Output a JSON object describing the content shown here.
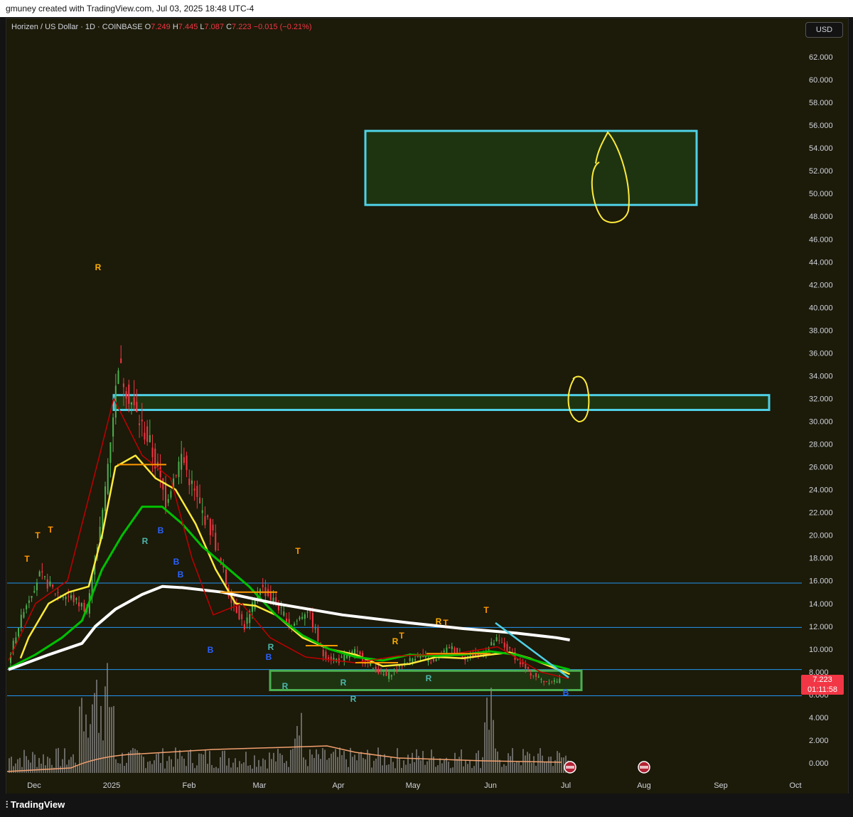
{
  "header": {
    "attribution": "gmuney created with TradingView.com, Jul 03, 2025 18:48 UTC-4"
  },
  "legend": {
    "symbol": "Horizen / US Dollar · 1D · COINBASE",
    "open_label": "O",
    "open": "7.249",
    "high_label": "H",
    "high": "7.445",
    "low_label": "L",
    "low": "7.087",
    "close_label": "C",
    "close": "7.223",
    "change": "−0.015 (−0.21%)"
  },
  "currency_button": "USD",
  "last_price": {
    "price": "7.223",
    "countdown": "01:11:58"
  },
  "footer": {
    "brand": "TradingView"
  },
  "colors": {
    "background": "#1c1a09",
    "up": "#4caf50",
    "down": "#f23645",
    "zone_fill": "#1f3a12",
    "zone_border_cyan": "#4fd1e6",
    "zone_border_green": "#4caf50",
    "ema_short": "#ffeb3b",
    "ema_mid": "#00c000",
    "ema_long": "#ffffff",
    "ema_red": "#c00000",
    "hlines": "#2196f3",
    "annotation": "#ffeb3b"
  },
  "chart_data": {
    "type": "candlestick",
    "title": "Horizen / US Dollar · 1D · COINBASE",
    "y_axis": {
      "ticks": [
        "62.000",
        "60.000",
        "58.000",
        "56.000",
        "54.000",
        "52.000",
        "50.000",
        "48.000",
        "46.000",
        "44.000",
        "42.000",
        "40.000",
        "38.000",
        "36.000",
        "34.000",
        "32.000",
        "30.000",
        "28.000",
        "26.000",
        "24.000",
        "22.000",
        "20.000",
        "18.000",
        "16.000",
        "14.000",
        "12.000",
        "10.000",
        "8.000",
        "6.000",
        "4.000",
        "2.000",
        "0.000"
      ],
      "range": [
        -1,
        63
      ]
    },
    "x_axis": {
      "ticks": [
        "Dec",
        "2025",
        "Feb",
        "Mar",
        "Apr",
        "May",
        "Jun",
        "Jul",
        "Aug",
        "Sep",
        "Oct"
      ]
    },
    "price_path": [
      {
        "date": "Nov 22",
        "close": 9.0
      },
      {
        "date": "Nov 28",
        "close": 13.5
      },
      {
        "date": "Dec 3",
        "close": 16.5
      },
      {
        "date": "Dec 8",
        "close": 15.0
      },
      {
        "date": "Dec 13",
        "close": 14.5
      },
      {
        "date": "Dec 18",
        "close": 13.5
      },
      {
        "date": "Dec 23",
        "close": 22.0
      },
      {
        "date": "Dec 27",
        "close": 35.0
      },
      {
        "date": "Dec 31",
        "close": 31.0
      },
      {
        "date": "Jan 5",
        "close": 28.0
      },
      {
        "date": "Jan 10",
        "close": 23.0
      },
      {
        "date": "Jan 15",
        "close": 27.0
      },
      {
        "date": "Jan 20",
        "close": 23.0
      },
      {
        "date": "Jan 25",
        "close": 20.0
      },
      {
        "date": "Feb 1",
        "close": 15.0
      },
      {
        "date": "Feb 6",
        "close": 12.0
      },
      {
        "date": "Feb 11",
        "close": 15.5
      },
      {
        "date": "Feb 18",
        "close": 14.0
      },
      {
        "date": "Feb 25",
        "close": 12.0
      },
      {
        "date": "Mar 4",
        "close": 13.5
      },
      {
        "date": "Mar 10",
        "close": 9.5
      },
      {
        "date": "Mar 17",
        "close": 9.0
      },
      {
        "date": "Mar 25",
        "close": 9.8
      },
      {
        "date": "Apr 1",
        "close": 8.5
      },
      {
        "date": "Apr 8",
        "close": 7.6
      },
      {
        "date": "Apr 15",
        "close": 8.6
      },
      {
        "date": "Apr 25",
        "close": 9.5
      },
      {
        "date": "May 5",
        "close": 8.8
      },
      {
        "date": "May 12",
        "close": 10.2
      },
      {
        "date": "May 20",
        "close": 9.3
      },
      {
        "date": "May 27",
        "close": 9.5
      },
      {
        "date": "Jun 3",
        "close": 10.8
      },
      {
        "date": "Jun 10",
        "close": 9.6
      },
      {
        "date": "Jun 18",
        "close": 8.0
      },
      {
        "date": "Jun 25",
        "close": 7.2
      },
      {
        "date": "Jul 3",
        "close": 7.223
      }
    ],
    "indicators": [
      {
        "color": "yellow",
        "points": [
          [
            9.0,
            9.2
          ],
          [
            15,
            11
          ],
          [
            30,
            14
          ],
          [
            45,
            15
          ],
          [
            60,
            15.5
          ],
          [
            70,
            20
          ],
          [
            80,
            26
          ],
          [
            95,
            27
          ],
          [
            110,
            25
          ],
          [
            125,
            24
          ],
          [
            140,
            21
          ],
          [
            155,
            17
          ],
          [
            170,
            14
          ],
          [
            185,
            13.8
          ],
          [
            200,
            13
          ],
          [
            210,
            12
          ],
          [
            220,
            11
          ],
          [
            240,
            10
          ],
          [
            260,
            9.5
          ],
          [
            280,
            8.5
          ],
          [
            300,
            8.7
          ],
          [
            320,
            9.3
          ],
          [
            340,
            9.2
          ],
          [
            360,
            9.5
          ],
          [
            375,
            9.7
          ],
          [
            390,
            9.2
          ],
          [
            405,
            8.5
          ],
          [
            420,
            7.8
          ]
        ]
      },
      {
        "color": "green",
        "points": [
          [
            0,
            8.3
          ],
          [
            20,
            9.5
          ],
          [
            40,
            11
          ],
          [
            55,
            12.5
          ],
          [
            70,
            17
          ],
          [
            85,
            20
          ],
          [
            100,
            22.5
          ],
          [
            115,
            22.5
          ],
          [
            130,
            21
          ],
          [
            145,
            19
          ],
          [
            160,
            17.5
          ],
          [
            180,
            15.5
          ],
          [
            200,
            13
          ],
          [
            220,
            11.2
          ],
          [
            240,
            10
          ],
          [
            260,
            9.3
          ],
          [
            280,
            9
          ],
          [
            300,
            9.5
          ],
          [
            320,
            9.4
          ],
          [
            340,
            9.5
          ],
          [
            360,
            9.8
          ],
          [
            380,
            9.5
          ],
          [
            400,
            8.8
          ],
          [
            420,
            8.2
          ]
        ]
      },
      {
        "color": "white",
        "points": [
          [
            0,
            8.2
          ],
          [
            30,
            9.5
          ],
          [
            55,
            10.5
          ],
          [
            65,
            12
          ],
          [
            80,
            13.5
          ],
          [
            100,
            14.8
          ],
          [
            115,
            15.5
          ],
          [
            130,
            15.4
          ],
          [
            160,
            15.0
          ],
          [
            200,
            14.0
          ],
          [
            250,
            13.0
          ],
          [
            300,
            12.3
          ],
          [
            340,
            11.8
          ],
          [
            380,
            11.4
          ],
          [
            410,
            11.0
          ],
          [
            420,
            10.8
          ]
        ]
      }
    ],
    "zones": [
      {
        "label": "upper box",
        "low": 49,
        "high": 55.5
      },
      {
        "label": "middle box",
        "low": 31,
        "high": 32.3
      },
      {
        "label": "support box",
        "low": 6.4,
        "high": 8.1
      }
    ],
    "horizontal_levels": [
      15.8,
      11.9,
      8.2,
      5.9
    ],
    "signals": [
      {
        "text": "T",
        "color": "#ff9800"
      },
      {
        "text": "T",
        "color": "#ff9800"
      },
      {
        "text": "T",
        "color": "#ff9800"
      },
      {
        "text": "R",
        "color": "#ffb000"
      },
      {
        "text": "R",
        "color": "#4db6ac"
      },
      {
        "text": "B",
        "color": "#2962ff"
      },
      {
        "text": "B",
        "color": "#2962ff"
      },
      {
        "text": "B",
        "color": "#2962ff"
      },
      {
        "text": "B",
        "color": "#2962ff"
      },
      {
        "text": "T",
        "color": "#ff9800"
      },
      {
        "text": "R",
        "color": "#4db6ac"
      },
      {
        "text": "B",
        "color": "#2962ff"
      },
      {
        "text": "R",
        "color": "#4db6ac"
      },
      {
        "text": "R",
        "color": "#4db6ac"
      },
      {
        "text": "R",
        "color": "#4db6ac"
      },
      {
        "text": "R",
        "color": "#ffb000"
      },
      {
        "text": "T",
        "color": "#ff9800"
      },
      {
        "text": "R",
        "color": "#4db6ac"
      },
      {
        "text": "R",
        "color": "#ffb000"
      },
      {
        "text": "T",
        "color": "#ff9800"
      },
      {
        "text": "T",
        "color": "#ff9800"
      },
      {
        "text": "B",
        "color": "#2962ff"
      }
    ]
  }
}
